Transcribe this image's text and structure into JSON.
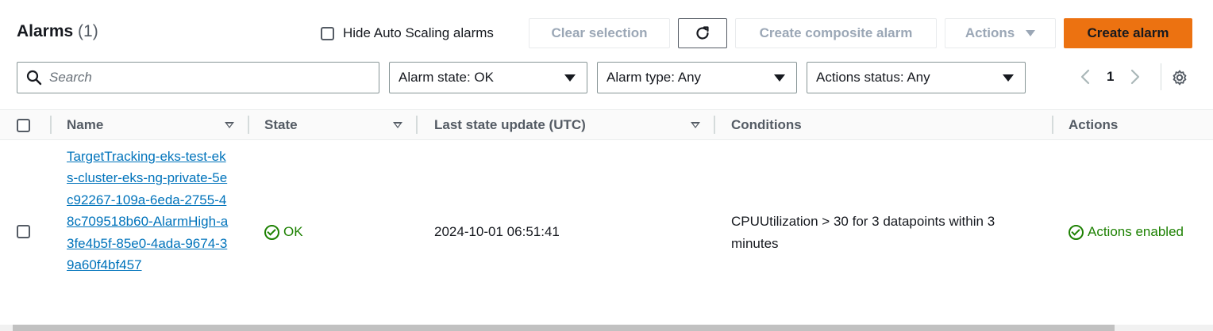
{
  "header": {
    "title": "Alarms",
    "count": "(1)",
    "hide_autoscaling_label": "Hide Auto Scaling alarms",
    "clear_selection_label": "Clear selection",
    "create_composite_label": "Create composite alarm",
    "actions_label": "Actions",
    "create_alarm_label": "Create alarm"
  },
  "filters": {
    "search_placeholder": "Search",
    "alarm_state": "Alarm state: OK",
    "alarm_type": "Alarm type: Any",
    "actions_status": "Actions status: Any"
  },
  "pagination": {
    "page": "1"
  },
  "table": {
    "columns": [
      "Name",
      "State",
      "Last state update (UTC)",
      "Conditions",
      "Actions"
    ],
    "rows": [
      {
        "name": "TargetTracking-eks-test-eks-cluster-eks-ng-private-5ec92267-109a-6eda-2755-48c709518b60-AlarmHigh-a3fe4b5f-85e0-4ada-9674-39a60f4bf457",
        "state": "OK",
        "last_update": "2024-10-01 06:51:41",
        "conditions": "CPUUtilization > 30 for 3 datapoints within 3 minutes",
        "actions": "Actions enabled"
      }
    ]
  },
  "colors": {
    "primary": "#ec7211",
    "link": "#0073bb",
    "success": "#1d8102"
  }
}
